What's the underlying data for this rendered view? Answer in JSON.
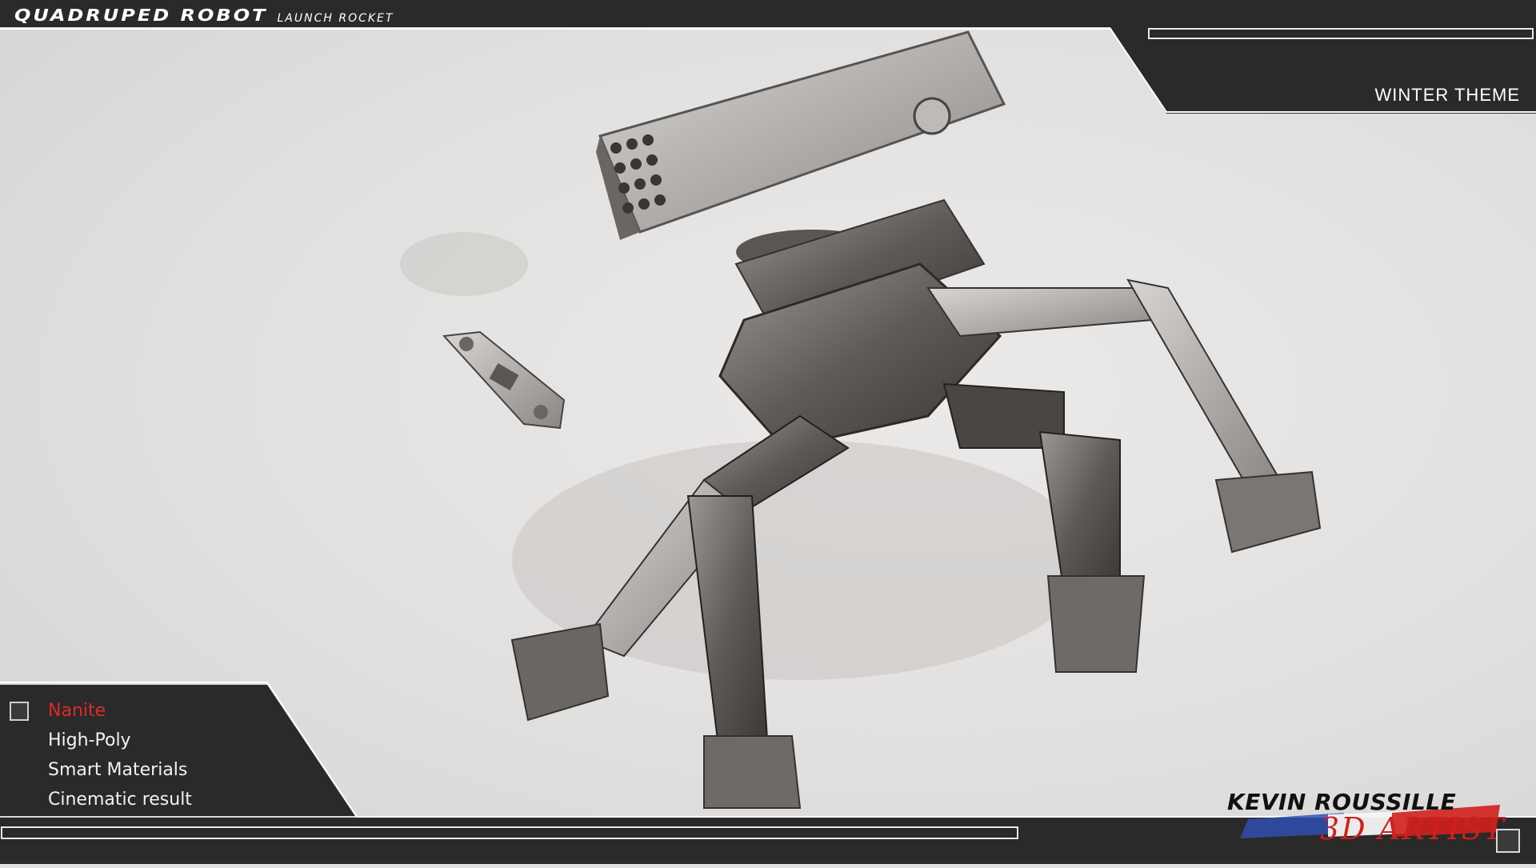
{
  "header": {
    "title": "QUADRUPED ROBOT",
    "subtitle": "LAUNCH ROCKET"
  },
  "theme": {
    "label": "WINTER THEME"
  },
  "menu": {
    "items": [
      {
        "label": "Nanite",
        "active": true
      },
      {
        "label": "High-Poly",
        "active": false
      },
      {
        "label": "Smart Materials",
        "active": false
      },
      {
        "label": "Cinematic result",
        "active": false
      }
    ]
  },
  "signature": {
    "name": "KEVIN ROUSSILLE",
    "art": "3D ARTIST"
  },
  "colors": {
    "panel": "#2a2a2a",
    "accent": "#e02a25",
    "stroke": "#ffffff"
  }
}
